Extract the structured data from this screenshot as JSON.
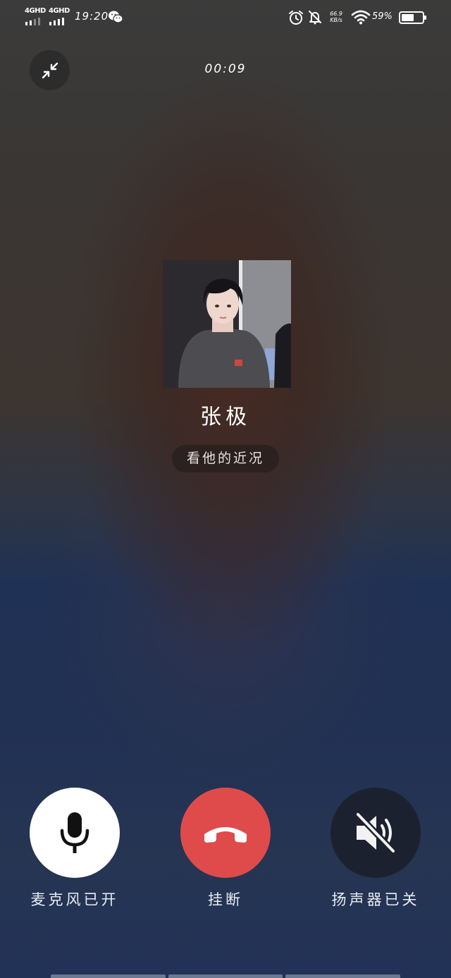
{
  "status_bar": {
    "sim1_label": "4GHD",
    "sim2_label": "4GHD",
    "time": "19:20",
    "net_speed_value": "66.9",
    "net_speed_unit": "KB/s",
    "battery_percent": "59%",
    "battery_level": 0.59
  },
  "call": {
    "duration": "00:09",
    "caller_name": "张极",
    "status_text": "看他的近况"
  },
  "controls": {
    "mic_label": "麦克风已开",
    "hangup_label": "挂断",
    "speaker_label": "扬声器已关"
  },
  "icons": {
    "minimize": "minimize-icon",
    "mic": "microphone-icon",
    "hangup": "phone-hangup-icon",
    "speaker": "speaker-muted-icon"
  },
  "colors": {
    "hangup_bg": "#df4b4b",
    "mic_bg": "#ffffff",
    "speaker_bg": "#1c2130"
  }
}
